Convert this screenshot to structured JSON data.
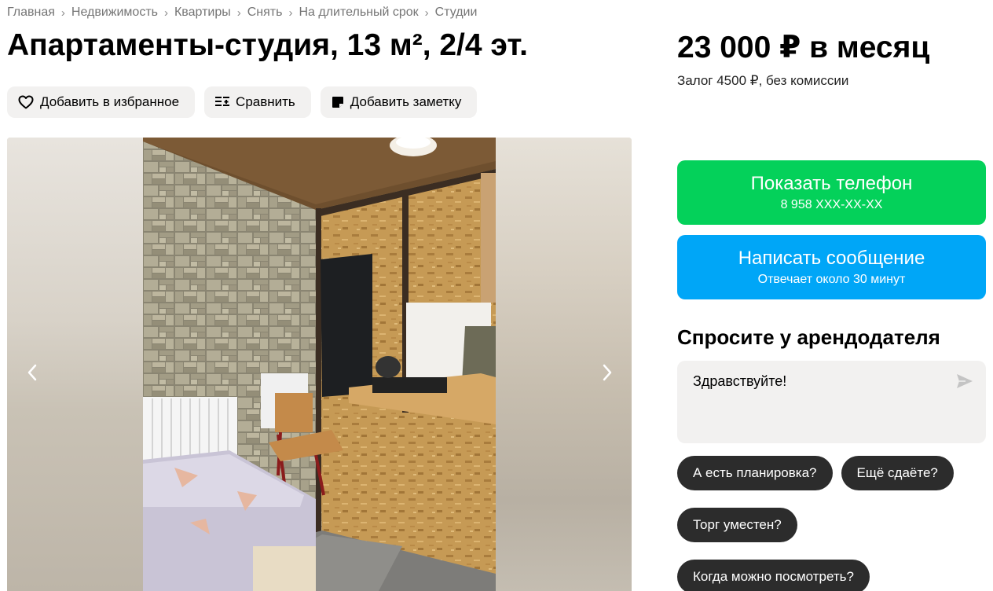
{
  "breadcrumbs": [
    {
      "label": "Главная"
    },
    {
      "label": "Недвижимость"
    },
    {
      "label": "Квартиры"
    },
    {
      "label": "Снять"
    },
    {
      "label": "На длительный срок"
    },
    {
      "label": "Студии"
    }
  ],
  "title": "Апартаменты-студия, 13 м², 2/4 эт.",
  "actions": {
    "favorite": "Добавить в избранное",
    "compare": "Сравнить",
    "note": "Добавить заметку"
  },
  "price": "23 000 ₽ в месяц",
  "deposit": "Залог 4500 ₽, без комиссии",
  "phone_button": {
    "label": "Показать телефон",
    "number": "8 958 XXX-XX-XX",
    "color": "#04d15a"
  },
  "message_button": {
    "label": "Написать сообщение",
    "sub": "Отвечает около 30 минут",
    "color": "#00a6f7"
  },
  "ask": {
    "title": "Спросите у арендодателя",
    "message": "Здравствуйте!",
    "chips": [
      "А есть планировка?",
      "Ещё сдаёте?",
      "Торг уместен?",
      "Когда можно посмотреть?"
    ]
  },
  "gallery": {
    "prev_icon": "chevron-left-icon",
    "next_icon": "chevron-right-icon",
    "photo_alt": "studio-room-photo"
  }
}
